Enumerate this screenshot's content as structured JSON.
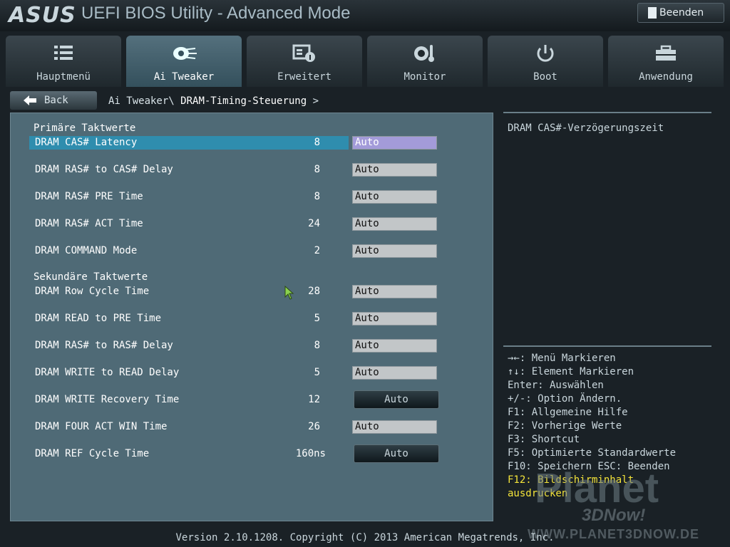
{
  "header": {
    "logo": "ASUS",
    "title": "UEFI BIOS Utility - Advanced Mode",
    "exit_label": "Beenden"
  },
  "tabs": [
    {
      "label": "Hauptmenü",
      "icon": "list-icon"
    },
    {
      "label": "Ai Tweaker",
      "icon": "ai-tweaker-icon"
    },
    {
      "label": "Erweitert",
      "icon": "advanced-icon"
    },
    {
      "label": "Monitor",
      "icon": "monitor-icon"
    },
    {
      "label": "Boot",
      "icon": "power-icon"
    },
    {
      "label": "Anwendung",
      "icon": "toolbox-icon"
    }
  ],
  "breadcrumb": {
    "back_label": "Back",
    "parent": "Ai Tweaker\\",
    "current": "DRAM-Timing-Steuerung",
    "chevron": ">"
  },
  "sections": {
    "primary": "Primäre Taktwerte",
    "secondary": "Sekundäre Taktwerte"
  },
  "rows": [
    {
      "name": "DRAM CAS# Latency",
      "value": "8",
      "setting": "Auto"
    },
    {
      "name": "DRAM RAS# to CAS# Delay",
      "value": "8",
      "setting": "Auto"
    },
    {
      "name": "DRAM RAS# PRE Time",
      "value": "8",
      "setting": "Auto"
    },
    {
      "name": "DRAM RAS# ACT Time",
      "value": "24",
      "setting": "Auto"
    },
    {
      "name": "DRAM COMMAND Mode",
      "value": "2",
      "setting": "Auto"
    },
    {
      "name": "DRAM Row Cycle Time",
      "value": "28",
      "setting": "Auto"
    },
    {
      "name": "DRAM READ to PRE Time",
      "value": "5",
      "setting": "Auto"
    },
    {
      "name": "DRAM RAS# to RAS# Delay",
      "value": "8",
      "setting": "Auto"
    },
    {
      "name": "DRAM WRITE to READ Delay",
      "value": "5",
      "setting": "Auto"
    },
    {
      "name": "DRAM WRITE Recovery Time",
      "value": "12",
      "setting": "Auto"
    },
    {
      "name": "DRAM FOUR ACT WIN Time",
      "value": "26",
      "setting": "Auto"
    },
    {
      "name": "DRAM REF Cycle Time",
      "value": "160ns",
      "setting": "Auto"
    }
  ],
  "help": {
    "description": "DRAM CAS#-Verzögerungszeit",
    "keys": [
      "→←: Menü Markieren",
      "↑↓: Element Markieren",
      "Enter: Auswählen",
      "+/-: Option Ändern.",
      "F1: Allgemeine Hilfe",
      "F2: Vorherige Werte",
      "F3: Shortcut",
      "F5: Optimierte Standardwerte",
      "F10: Speichern  ESC: Beenden"
    ],
    "highlight_1": "F12: Bildschirminhalt",
    "highlight_2": "ausdrucken"
  },
  "footer": "Version 2.10.1208. Copyright (C) 2013 American Megatrends, Inc.",
  "watermark": {
    "big": "Planet",
    "mid": "3DNow!",
    "url": "WWW.PLANET3DNOW.DE"
  },
  "colors": {
    "panel": "#4f6a76",
    "selected_row": "#2f8dae",
    "highlight_text": "#f4e43a"
  }
}
